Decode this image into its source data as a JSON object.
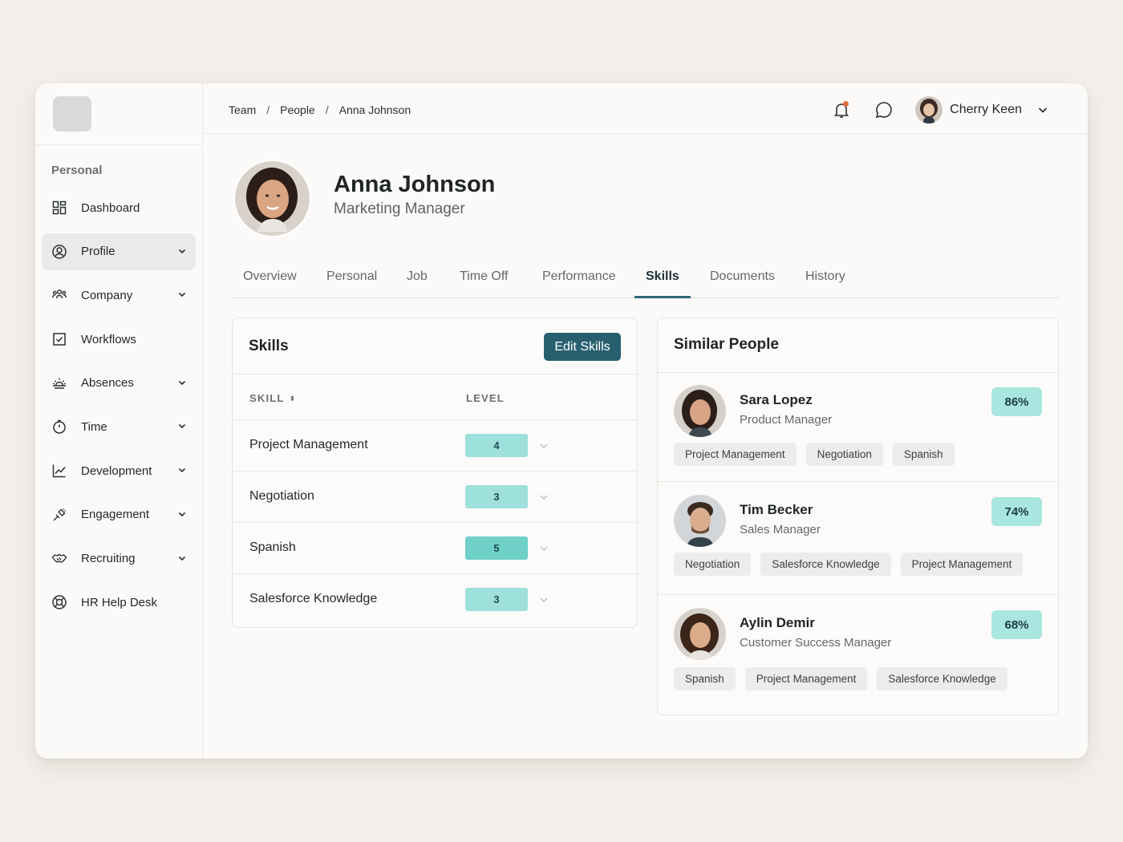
{
  "sidebar": {
    "section_label": "Personal",
    "items": [
      {
        "label": "Dashboard",
        "icon": "dashboard-icon",
        "has_chevron": false,
        "active": false
      },
      {
        "label": "Profile",
        "icon": "profile-icon",
        "has_chevron": true,
        "active": true
      },
      {
        "label": "Company",
        "icon": "company-icon",
        "has_chevron": true,
        "active": false
      },
      {
        "label": "Workflows",
        "icon": "workflows-icon",
        "has_chevron": false,
        "active": false
      },
      {
        "label": "Absences",
        "icon": "absences-icon",
        "has_chevron": true,
        "active": false
      },
      {
        "label": "Time",
        "icon": "time-icon",
        "has_chevron": true,
        "active": false
      },
      {
        "label": "Development",
        "icon": "development-icon",
        "has_chevron": true,
        "active": false
      },
      {
        "label": "Engagement",
        "icon": "engagement-icon",
        "has_chevron": true,
        "active": false
      },
      {
        "label": "Recruiting",
        "icon": "recruiting-icon",
        "has_chevron": true,
        "active": false
      },
      {
        "label": "HR Help Desk",
        "icon": "help-desk-icon",
        "has_chevron": false,
        "active": false
      }
    ]
  },
  "header": {
    "breadcrumb": [
      "Team",
      "People",
      "Anna Johnson"
    ],
    "breadcrumb_separator": "/",
    "user_name": "Cherry Keen",
    "has_notification": true
  },
  "profile": {
    "name": "Anna Johnson",
    "title": "Marketing Manager"
  },
  "tabs": [
    {
      "label": "Overview",
      "active": false
    },
    {
      "label": "Personal",
      "active": false
    },
    {
      "label": "Job",
      "active": false
    },
    {
      "label": "Time Off",
      "active": false
    },
    {
      "label": "Performance",
      "active": false
    },
    {
      "label": "Skills",
      "active": true
    },
    {
      "label": "Documents",
      "active": false
    },
    {
      "label": "History",
      "active": false
    }
  ],
  "skills": {
    "title": "Skills",
    "edit_label": "Edit Skills",
    "col_skill": "SKILL",
    "col_level": "LEVEL",
    "rows": [
      {
        "skill": "Project Management",
        "level": "4"
      },
      {
        "skill": "Negotiation",
        "level": "3"
      },
      {
        "skill": "Spanish",
        "level": "5"
      },
      {
        "skill": "Salesforce Knowledge",
        "level": "3"
      }
    ]
  },
  "similar": {
    "title": "Similar People",
    "people": [
      {
        "name": "Sara Lopez",
        "role": "Product Manager",
        "match": "86%",
        "skills": [
          "Project Management",
          "Negotiation",
          "Spanish"
        ]
      },
      {
        "name": "Tim Becker",
        "role": "Sales Manager",
        "match": "74%",
        "skills": [
          "Negotiation",
          "Salesforce Knowledge",
          "Project Management"
        ]
      },
      {
        "name": "Aylin Demir",
        "role": "Customer Success Manager",
        "match": "68%",
        "skills": [
          "Spanish",
          "Project Management",
          "Salesforce Knowledge"
        ]
      }
    ]
  },
  "colors": {
    "accent": "#285f6e",
    "level_pill": "#9ee0db",
    "level_pill_strong": "#6fd0c8",
    "match_badge": "#a9e6df",
    "notification_dot": "#e2703a"
  }
}
